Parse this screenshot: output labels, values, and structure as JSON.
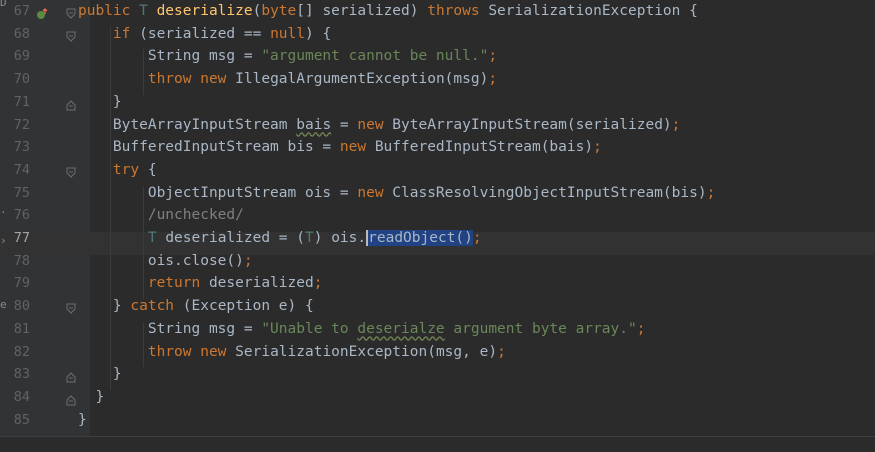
{
  "editor": {
    "current_line": "77",
    "left_strip": [
      "D",
      "·",
      "›",
      "er"
    ],
    "lines": [
      {
        "num": "67",
        "fold": "open",
        "marker": "override",
        "tokens": [
          {
            "t": "public ",
            "c": "kw"
          },
          {
            "t": "T ",
            "c": "ty2"
          },
          {
            "t": "deserialize",
            "c": "fn"
          },
          {
            "t": "(",
            "c": ""
          },
          {
            "t": "byte",
            "c": "kw"
          },
          {
            "t": "[] serialized) ",
            "c": ""
          },
          {
            "t": "throws ",
            "c": "kw"
          },
          {
            "t": "SerializationException {",
            "c": ""
          }
        ]
      },
      {
        "num": "68",
        "fold": "open",
        "tokens": [
          {
            "t": "    "
          },
          {
            "t": "if ",
            "c": "kw"
          },
          {
            "t": "(serialized == "
          },
          {
            "t": "null",
            "c": "kw"
          },
          {
            "t": ") {"
          }
        ]
      },
      {
        "num": "69",
        "fold": "",
        "tokens": [
          {
            "t": "        String msg = "
          },
          {
            "t": "\"argument cannot be null.\"",
            "c": "str"
          },
          {
            "t": ";",
            "c": "kw"
          }
        ]
      },
      {
        "num": "70",
        "fold": "",
        "tokens": [
          {
            "t": "        "
          },
          {
            "t": "throw new ",
            "c": "kw"
          },
          {
            "t": "IllegalArgumentException(msg)"
          },
          {
            "t": ";",
            "c": "kw"
          }
        ]
      },
      {
        "num": "71",
        "fold": "close",
        "tokens": [
          {
            "t": "    }"
          }
        ]
      },
      {
        "num": "72",
        "fold": "",
        "tokens": [
          {
            "t": "    ByteArrayInputStream "
          },
          {
            "t": "bais",
            "c": "warn"
          },
          {
            "t": " = "
          },
          {
            "t": "new ",
            "c": "kw"
          },
          {
            "t": "ByteArrayInputStream(serialized)"
          },
          {
            "t": ";",
            "c": "kw"
          }
        ]
      },
      {
        "num": "73",
        "fold": "",
        "tokens": [
          {
            "t": "    BufferedInputStream bis = "
          },
          {
            "t": "new ",
            "c": "kw"
          },
          {
            "t": "BufferedInputStream(bais)"
          },
          {
            "t": ";",
            "c": "kw"
          }
        ]
      },
      {
        "num": "74",
        "fold": "open",
        "tokens": [
          {
            "t": "    "
          },
          {
            "t": "try ",
            "c": "kw"
          },
          {
            "t": "{"
          }
        ]
      },
      {
        "num": "75",
        "fold": "",
        "tokens": [
          {
            "t": "        ObjectInputStream ois = "
          },
          {
            "t": "new ",
            "c": "kw"
          },
          {
            "t": "ClassResolvingObjectInputStream(bis)"
          },
          {
            "t": ";",
            "c": "kw"
          }
        ]
      },
      {
        "num": "76",
        "fold": "",
        "tokens": [
          {
            "t": "        "
          },
          {
            "t": "/unchecked/",
            "c": "cm"
          }
        ]
      },
      {
        "num": "77",
        "fold": "",
        "tokens": [
          {
            "t": "        "
          },
          {
            "t": "T ",
            "c": "ty2"
          },
          {
            "t": "deserialized = ("
          },
          {
            "t": "T",
            "c": "ty2"
          },
          {
            "t": ") ois."
          },
          {
            "t": "readObject()",
            "c": "sel"
          },
          {
            "t": ";",
            "c": "kw"
          }
        ]
      },
      {
        "num": "78",
        "fold": "",
        "tokens": [
          {
            "t": "        ois.close()"
          },
          {
            "t": ";",
            "c": "kw"
          }
        ]
      },
      {
        "num": "79",
        "fold": "",
        "tokens": [
          {
            "t": "        "
          },
          {
            "t": "return ",
            "c": "kw"
          },
          {
            "t": "deserialized"
          },
          {
            "t": ";",
            "c": "kw"
          }
        ]
      },
      {
        "num": "80",
        "fold": "open",
        "tokens": [
          {
            "t": "    } "
          },
          {
            "t": "catch ",
            "c": "kw"
          },
          {
            "t": "(Exception e) {"
          }
        ]
      },
      {
        "num": "81",
        "fold": "",
        "tokens": [
          {
            "t": "        String msg = "
          },
          {
            "t": "\"Unable to ",
            "c": "str"
          },
          {
            "t": "deserialze",
            "c": "str warn"
          },
          {
            "t": " argument byte array.\"",
            "c": "str"
          },
          {
            "t": ";",
            "c": "kw"
          }
        ]
      },
      {
        "num": "82",
        "fold": "",
        "tokens": [
          {
            "t": "        "
          },
          {
            "t": "throw new ",
            "c": "kw"
          },
          {
            "t": "SerializationException(msg, e)"
          },
          {
            "t": ";",
            "c": "kw"
          }
        ]
      },
      {
        "num": "83",
        "fold": "close",
        "tokens": [
          {
            "t": "    }"
          }
        ]
      },
      {
        "num": "84",
        "fold": "close",
        "tokens": [
          {
            "t": "  }"
          }
        ]
      },
      {
        "num": "85",
        "fold": "",
        "tokens": [
          {
            "t": "}"
          }
        ]
      }
    ]
  }
}
